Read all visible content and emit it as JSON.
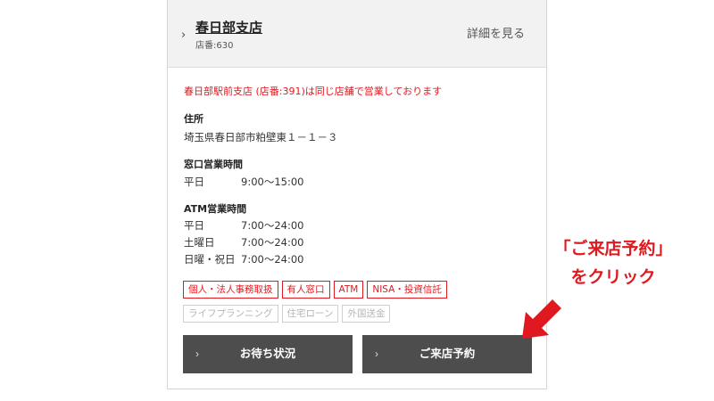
{
  "branch": {
    "name": "春日部支店",
    "number": "店番:630",
    "detail_link": "詳細を見る"
  },
  "notice": "春日部駅前支店 (店番:391)は同じ店舗で営業しております",
  "address": {
    "title": "住所",
    "value": "埼玉県春日部市粕壁東１－１－３"
  },
  "counter_hours": {
    "title": "窓口営業時間",
    "rows": [
      {
        "day": "平日",
        "time": "9:00～15:00"
      }
    ]
  },
  "atm_hours": {
    "title": "ATM営業時間",
    "rows": [
      {
        "day": "平日",
        "time": "7:00～24:00"
      },
      {
        "day": "土曜日",
        "time": "7:00～24:00"
      },
      {
        "day": "日曜・祝日",
        "time": "7:00～24:00"
      }
    ]
  },
  "tags_active": [
    "個人・法人事務取扱",
    "有人窓口",
    "ATM",
    "NISA・投資信託"
  ],
  "tags_inactive": [
    "ライフプランニング",
    "住宅ローン",
    "外国送金"
  ],
  "buttons": {
    "wait_status": "お待ち状況",
    "reserve": "ご来店予約"
  },
  "annotation": {
    "line1": "「ご来店予約」",
    "line2": "をクリック"
  },
  "colors": {
    "accent_red": "#e0181f",
    "button_dark": "#4d4d4d",
    "header_bg": "#f2f2f2"
  },
  "icons": {
    "chevron": "›",
    "arrow": "arrow-down-left-icon"
  }
}
